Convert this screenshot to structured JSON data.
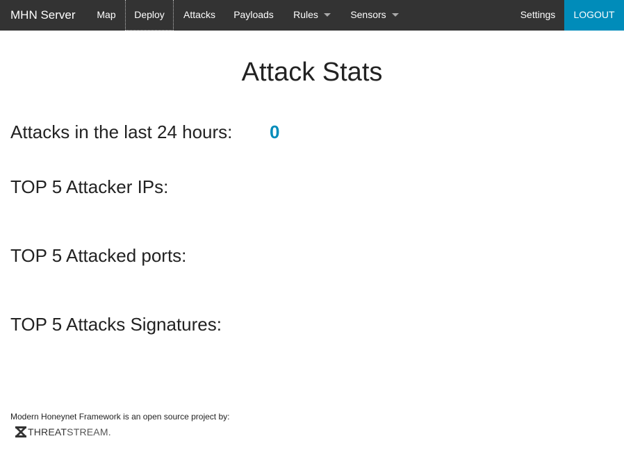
{
  "navbar": {
    "brand": "MHN Server",
    "items": [
      {
        "label": "Map"
      },
      {
        "label": "Deploy"
      },
      {
        "label": "Attacks"
      },
      {
        "label": "Payloads"
      },
      {
        "label": "Rules"
      },
      {
        "label": "Sensors"
      }
    ],
    "settings": "Settings",
    "logout": "LOGOUT"
  },
  "icons": {
    "dropdown": "caret-down-icon",
    "logo": "threatstream-logo"
  },
  "colors": {
    "navbar_bg": "#333333",
    "accent": "#008cba"
  },
  "main": {
    "title": "Attack Stats",
    "attacks_24h_label": "Attacks in the last 24 hours:",
    "attacks_24h_value": "0",
    "top_ips_label": "TOP 5 Attacker IPs:",
    "top_ports_label": "TOP 5 Attacked ports:",
    "top_signatures_label": "TOP 5 Attacks Signatures:"
  },
  "footer": {
    "text": "Modern Honeynet Framework is an open source project by:",
    "logo_bold": "THREAT",
    "logo_light": "STREAM."
  }
}
